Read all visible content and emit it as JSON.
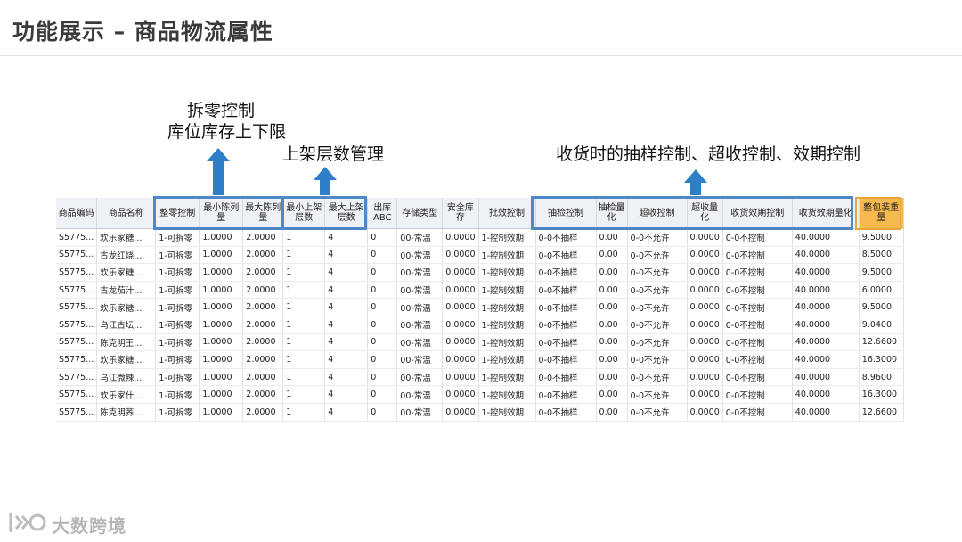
{
  "slide": {
    "title": "功能展示 – 商品物流属性"
  },
  "annotations": {
    "split": [
      "拆零控制",
      "库位库存上下限"
    ],
    "shelf": "上架层数管理",
    "receiving": "收货时的抽样控制、超收控制、效期控制"
  },
  "table": {
    "columns": [
      {
        "label": "商品编码"
      },
      {
        "label": "商品名称"
      },
      {
        "label": "整零控制"
      },
      {
        "label": "最小陈列量"
      },
      {
        "label": "最大陈列量"
      },
      {
        "label": "最小上架层数"
      },
      {
        "label": "最大上架层数"
      },
      {
        "label": "出库ABC"
      },
      {
        "label": "存储类型"
      },
      {
        "label": "安全库存"
      },
      {
        "label": "批效控制"
      },
      {
        "label": "抽检控制"
      },
      {
        "label": "抽检量化"
      },
      {
        "label": "超收控制"
      },
      {
        "label": "超收量化"
      },
      {
        "label": "收货效期控制"
      },
      {
        "label": "收货效期量化"
      },
      {
        "label": "整包装重量"
      }
    ],
    "rows": [
      [
        "S5775...",
        "欢乐家糖...",
        "1-可拆零",
        "1.0000",
        "2.0000",
        "1",
        "4",
        "0",
        "00-常温",
        "0.0000",
        "1-控制效期",
        "0-0不抽样",
        "0.00",
        "0-0不允许",
        "0.0000",
        "0-0不控制",
        "40.0000",
        "9.5000"
      ],
      [
        "S5775...",
        "古龙红烧...",
        "1-可拆零",
        "1.0000",
        "2.0000",
        "1",
        "4",
        "0",
        "00-常温",
        "0.0000",
        "1-控制效期",
        "0-0不抽样",
        "0.00",
        "0-0不允许",
        "0.0000",
        "0-0不控制",
        "40.0000",
        "8.5000"
      ],
      [
        "S5775...",
        "欢乐家糖...",
        "1-可拆零",
        "1.0000",
        "2.0000",
        "1",
        "4",
        "0",
        "00-常温",
        "0.0000",
        "1-控制效期",
        "0-0不抽样",
        "0.00",
        "0-0不允许",
        "0.0000",
        "0-0不控制",
        "40.0000",
        "9.5000"
      ],
      [
        "S5775...",
        "古龙茄汁...",
        "1-可拆零",
        "1.0000",
        "2.0000",
        "1",
        "4",
        "0",
        "00-常温",
        "0.0000",
        "1-控制效期",
        "0-0不抽样",
        "0.00",
        "0-0不允许",
        "0.0000",
        "0-0不控制",
        "40.0000",
        "6.0000"
      ],
      [
        "S5775...",
        "欢乐家糖...",
        "1-可拆零",
        "1.0000",
        "2.0000",
        "1",
        "4",
        "0",
        "00-常温",
        "0.0000",
        "1-控制效期",
        "0-0不抽样",
        "0.00",
        "0-0不允许",
        "0.0000",
        "0-0不控制",
        "40.0000",
        "9.5000"
      ],
      [
        "S5775...",
        "乌江古坛...",
        "1-可拆零",
        "1.0000",
        "2.0000",
        "1",
        "4",
        "0",
        "00-常温",
        "0.0000",
        "1-控制效期",
        "0-0不抽样",
        "0.00",
        "0-0不允许",
        "0.0000",
        "0-0不控制",
        "40.0000",
        "9.0400"
      ],
      [
        "S5775...",
        "陈克明王...",
        "1-可拆零",
        "1.0000",
        "2.0000",
        "1",
        "4",
        "0",
        "00-常温",
        "0.0000",
        "1-控制效期",
        "0-0不抽样",
        "0.00",
        "0-0不允许",
        "0.0000",
        "0-0不控制",
        "40.0000",
        "12.6600"
      ],
      [
        "S5775...",
        "欢乐家糖...",
        "1-可拆零",
        "1.0000",
        "2.0000",
        "1",
        "4",
        "0",
        "00-常温",
        "0.0000",
        "1-控制效期",
        "0-0不抽样",
        "0.00",
        "0-0不允许",
        "0.0000",
        "0-0不控制",
        "40.0000",
        "16.3000"
      ],
      [
        "S5775...",
        "乌江微辣...",
        "1-可拆零",
        "1.0000",
        "2.0000",
        "1",
        "4",
        "0",
        "00-常温",
        "0.0000",
        "1-控制效期",
        "0-0不抽样",
        "0.00",
        "0-0不允许",
        "0.0000",
        "0-0不控制",
        "40.0000",
        "8.9600"
      ],
      [
        "S5775...",
        "欢乐家什...",
        "1-可拆零",
        "1.0000",
        "2.0000",
        "1",
        "4",
        "0",
        "00-常温",
        "0.0000",
        "1-控制效期",
        "0-0不抽样",
        "0.00",
        "0-0不允许",
        "0.0000",
        "0-0不控制",
        "40.0000",
        "16.3000"
      ],
      [
        "S5775...",
        "陈克明荞...",
        "1-可拆零",
        "1.0000",
        "2.0000",
        "1",
        "4",
        "0",
        "00-常温",
        "0.0000",
        "1-控制效期",
        "0-0不抽样",
        "0.00",
        "0-0不允许",
        "0.0000",
        "0-0不控制",
        "40.0000",
        "12.6600"
      ]
    ]
  },
  "footer": {
    "brand": "大数跨境",
    "logo_mark": "I<<O"
  },
  "colors": {
    "accent": "#2f7fc8",
    "box": "#4f88c9",
    "highlight": "#f5b94e",
    "header_bg": "#eef1f5"
  }
}
